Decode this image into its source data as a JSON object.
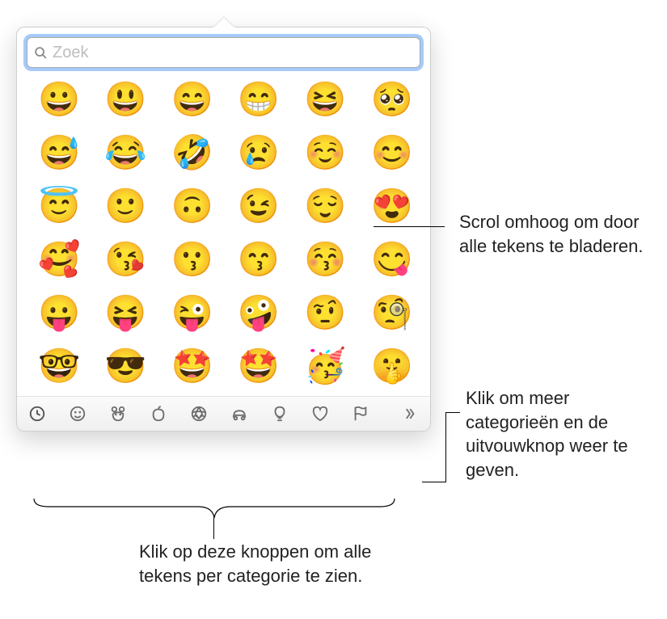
{
  "search": {
    "placeholder": "Zoek",
    "value": ""
  },
  "emoji": {
    "rows": [
      [
        "😀",
        "😃",
        "😄",
        "😁",
        "😆",
        "🥺"
      ],
      [
        "😅",
        "😂",
        "🤣",
        "😢",
        "☺️",
        "😊"
      ],
      [
        "😇",
        "🙂",
        "🙃",
        "😉",
        "😌",
        "😍"
      ],
      [
        "🥰",
        "😘",
        "😗",
        "😙",
        "😚",
        "😋"
      ],
      [
        "😛",
        "😝",
        "😜",
        "🤪",
        "🤨",
        "🧐"
      ],
      [
        "🤓",
        "😎",
        "🤩",
        "🤩",
        "🥳",
        "🤫"
      ]
    ]
  },
  "categories": [
    {
      "name": "recent-icon",
      "label": "Recent"
    },
    {
      "name": "smiley-icon",
      "label": "Smileys"
    },
    {
      "name": "animal-icon",
      "label": "Animals"
    },
    {
      "name": "food-icon",
      "label": "Food"
    },
    {
      "name": "activity-icon",
      "label": "Activity"
    },
    {
      "name": "travel-icon",
      "label": "Travel"
    },
    {
      "name": "object-icon",
      "label": "Objects"
    },
    {
      "name": "heart-icon",
      "label": "Symbols"
    },
    {
      "name": "flag-icon",
      "label": "Flags"
    }
  ],
  "annotations": {
    "scroll": "Scrol omhoog om door alle tekens te bladeren.",
    "categories": "Klik op deze knoppen om alle tekens per categorie te zien.",
    "expand": "Klik om meer categorieën en de uitvouwknop weer te geven."
  }
}
